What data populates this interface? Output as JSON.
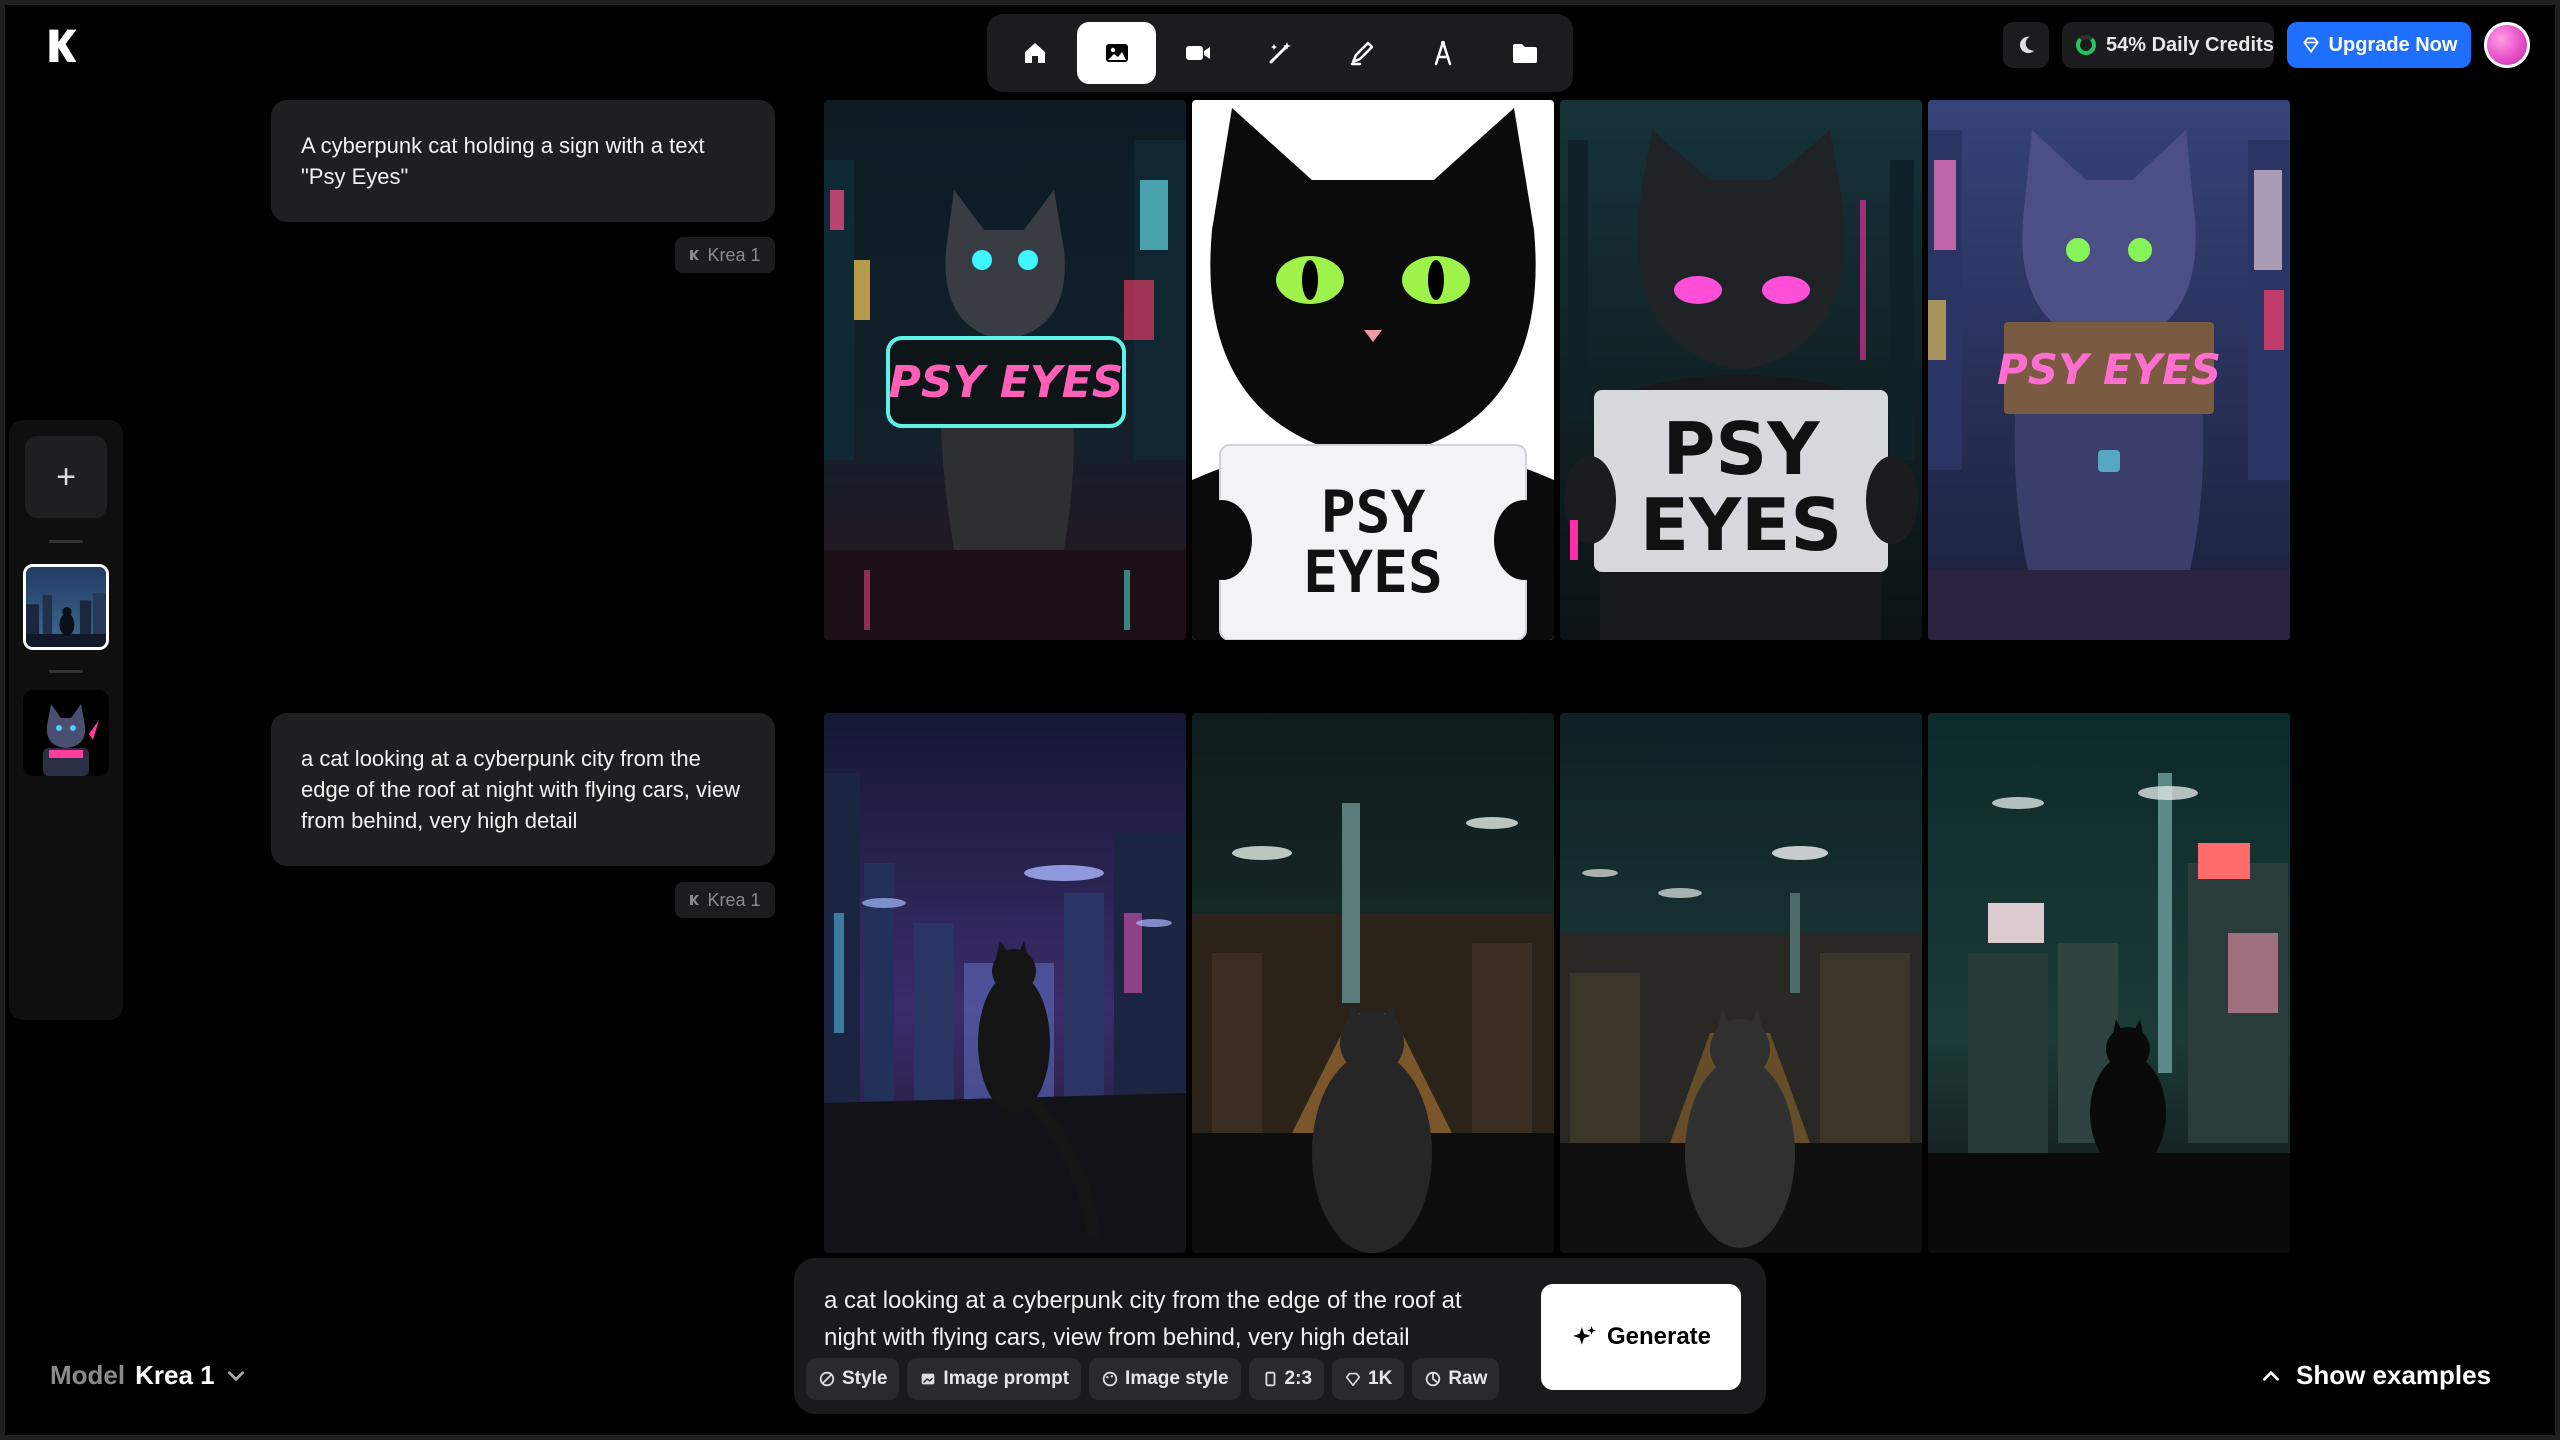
{
  "app": {
    "logo": "krea-logo"
  },
  "toolbar": {
    "tools": [
      {
        "icon": "home-icon"
      },
      {
        "icon": "image-icon"
      },
      {
        "icon": "video-icon"
      },
      {
        "icon": "enhance-icon"
      },
      {
        "icon": "edit-icon"
      },
      {
        "icon": "train-icon"
      },
      {
        "icon": "folder-icon"
      }
    ]
  },
  "header": {
    "credits_label": "54% Daily Credits",
    "upgrade_label": "Upgrade Now"
  },
  "history": {
    "generations": [
      {
        "prompt": "A cyberpunk cat holding a sign with a text \"Psy Eyes\"",
        "model": "Krea 1"
      },
      {
        "prompt": "a cat looking at a cyberpunk city from the edge of the roof at night with flying cars, view from behind, very high detail",
        "model": "Krea 1"
      }
    ]
  },
  "sign_texts": [
    "PSY EYES",
    "PSY",
    "EYES",
    "PSY",
    "EYES",
    "PSY EYES"
  ],
  "model_select": {
    "label": "Model",
    "value": "Krea 1"
  },
  "composer": {
    "prompt_value": "a cat looking at a cyberpunk city from the edge of the roof at night with flying cars, view from behind, very high detail",
    "generate_label": "Generate",
    "chips": [
      {
        "label": "Style",
        "icon": "style-icon"
      },
      {
        "label": "Image prompt",
        "icon": "image-prompt-icon"
      },
      {
        "label": "Image style",
        "icon": "palette-icon"
      },
      {
        "label": "2:3",
        "icon": "aspect-ratio-icon"
      },
      {
        "label": "1K",
        "icon": "resolution-icon"
      },
      {
        "label": "Raw",
        "icon": "raw-icon"
      }
    ]
  },
  "examples": {
    "label": "Show examples"
  },
  "colors": {
    "accent": "#1f6fff",
    "credits": "#22c55e",
    "panel": "#1c1c1e"
  }
}
